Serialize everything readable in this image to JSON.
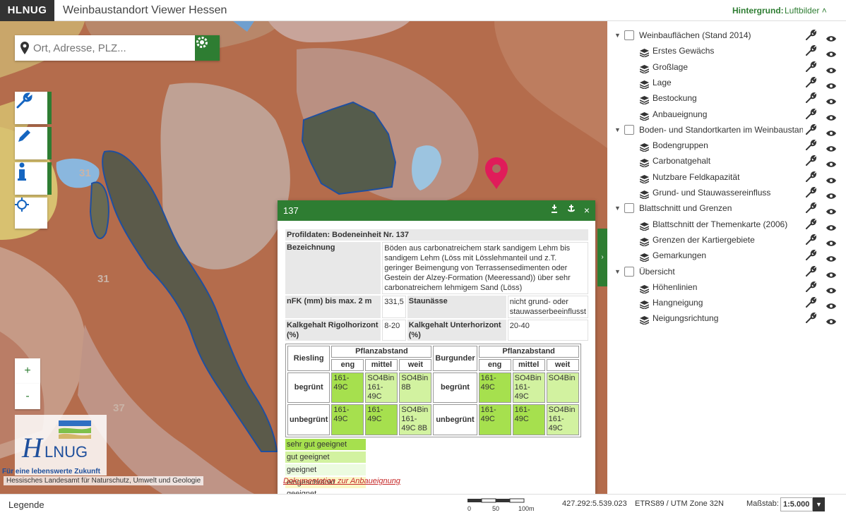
{
  "header": {
    "brand": "HLNUG",
    "title": "Weinbaustandort Viewer Hessen",
    "background_label": "Hintergrund:",
    "background_value": "Luftbilder ˄"
  },
  "search": {
    "placeholder": "Ort, Adresse, PLZ..."
  },
  "map": {
    "labels": [
      "31",
      "31",
      "37"
    ],
    "zoom_in": "+",
    "zoom_out": "-"
  },
  "logo": {
    "text": "HLNUG",
    "tagline": "Für eine lebenswerte Zukunft",
    "caption": "Hessisches Landesamt für Naturschutz, Umwelt und Geologie"
  },
  "popup": {
    "title": "137",
    "close": "×",
    "profile_header": "Profildaten: Bodeneinheit Nr. 137",
    "bezeichnung_label": "Bezeichnung",
    "bezeichnung_value": "Böden aus carbonatreichem stark sandigem Lehm bis sandigem Lehm (Löss mit Lösslehmanteil und z.T. geringer Beimengung von Terrassensedimenten oder Gestein der Alzey-Formation (Meeressand)) über sehr carbonatreichem lehmigem Sand (Löss)",
    "nfk_label": "nFK (mm) bis max. 2 m",
    "nfk_value": "331,5",
    "staunaesse_label": "Staunässe",
    "staunaesse_value": "nicht grund- oder stauwasserbeeinflusst",
    "kalk_rigol_label": "Kalkgehalt Rigolhorizont (%)",
    "kalk_rigol_value": "8-20",
    "kalk_unter_label": "Kalkgehalt Unterhorizont (%)",
    "kalk_unter_value": "20-40",
    "grid": {
      "riesling": "Riesling",
      "burgunder": "Burgunder",
      "pflanzabstand": "Pflanzabstand",
      "cols": [
        "eng",
        "mittel",
        "weit"
      ],
      "rows": [
        {
          "label": "begrünt",
          "riesling": [
            "161-49C",
            "SO4Bin 161-49C",
            "SO4Bin 8B"
          ],
          "burgunder": [
            "161-49C",
            "SO4Bin 161-49C",
            "SO4Bin"
          ]
        },
        {
          "label": "unbegrünt",
          "riesling": [
            "161-49C",
            "161-49C",
            "SO4Bin 161-49C 8B"
          ],
          "burgunder": [
            "161-49C",
            "161-49C",
            "SO4Bin 161-49C"
          ]
        }
      ]
    },
    "legend": [
      {
        "label": "sehr gut geeignet",
        "color": "#a6e04e"
      },
      {
        "label": "gut geeignet",
        "color": "#d2f2a0"
      },
      {
        "label": "geeignet",
        "color": "#ecfbe0"
      },
      {
        "label": "eingeschränkt geeignet",
        "color": "#fbf7c8"
      }
    ],
    "doc_link": "Dokumentation zur Anbaueignung"
  },
  "layers": [
    {
      "type": "group",
      "label": "Weinbauflächen (Stand 2014)"
    },
    {
      "type": "layer",
      "label": "Erstes Gewächs"
    },
    {
      "type": "layer",
      "label": "Großlage"
    },
    {
      "type": "layer",
      "label": "Lage"
    },
    {
      "type": "layer",
      "label": "Bestockung"
    },
    {
      "type": "layer",
      "label": "Anbaueignung"
    },
    {
      "type": "group",
      "label": "Boden- und Standortkarten im Weinbaustandort"
    },
    {
      "type": "layer",
      "label": "Bodengruppen"
    },
    {
      "type": "layer",
      "label": "Carbonatgehalt"
    },
    {
      "type": "layer",
      "label": "Nutzbare Feldkapazität"
    },
    {
      "type": "layer",
      "label": "Grund- und Stauwassereinfluss"
    },
    {
      "type": "group",
      "label": "Blattschnitt und Grenzen"
    },
    {
      "type": "layer",
      "label": "Blattschnitt der Themenkarte (2006)"
    },
    {
      "type": "layer",
      "label": "Grenzen der Kartiergebiete"
    },
    {
      "type": "layer",
      "label": "Gemarkungen"
    },
    {
      "type": "group",
      "label": "Übersicht"
    },
    {
      "type": "layer",
      "label": "Höhenlinien"
    },
    {
      "type": "layer",
      "label": "Hangneigung"
    },
    {
      "type": "layer",
      "label": "Neigungsrichtung"
    }
  ],
  "status": {
    "legende": "Legende",
    "scale_ticks": [
      "0",
      "50",
      "100m"
    ],
    "coordinates": "427.292:5.539.023",
    "crs": "ETRS89 / UTM Zone 32N",
    "scale_label": "Maßstab:",
    "scale_value": "1:5.000"
  }
}
